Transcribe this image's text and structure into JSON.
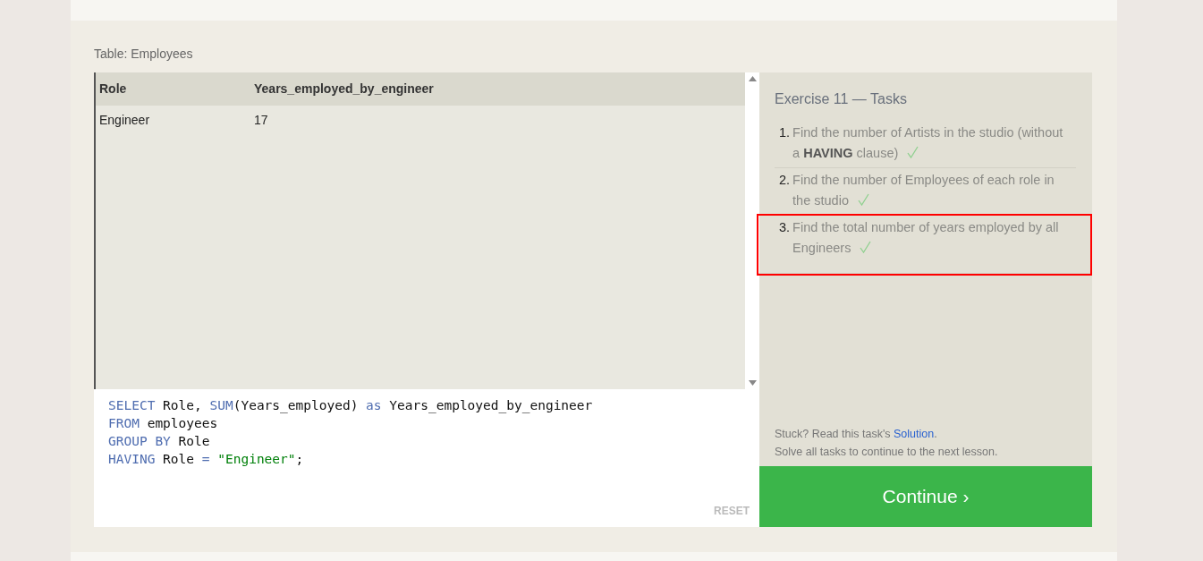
{
  "table_caption": "Table: Employees",
  "result_table": {
    "columns": [
      "Role",
      "Years_employed_by_engineer"
    ],
    "rows": [
      [
        "Engineer",
        "17"
      ]
    ]
  },
  "editor": {
    "lines": [
      [
        {
          "text": "SELECT",
          "kind": "keyword"
        },
        {
          "text": " Role, ",
          "kind": "plain"
        },
        {
          "text": "SUM",
          "kind": "keyword"
        },
        {
          "text": "(Years_employed) ",
          "kind": "plain"
        },
        {
          "text": "as",
          "kind": "keyword"
        },
        {
          "text": " Years_employed_by_engineer",
          "kind": "plain"
        }
      ],
      [
        {
          "text": "FROM",
          "kind": "keyword"
        },
        {
          "text": " employees",
          "kind": "plain"
        }
      ],
      [
        {
          "text": "GROUP BY",
          "kind": "keyword"
        },
        {
          "text": " Role",
          "kind": "plain"
        }
      ],
      [
        {
          "text": "HAVING",
          "kind": "keyword"
        },
        {
          "text": " Role ",
          "kind": "plain"
        },
        {
          "text": "=",
          "kind": "keyword"
        },
        {
          "text": " \"Engineer\"",
          "kind": "string"
        },
        {
          "text": ";",
          "kind": "plain"
        }
      ]
    ],
    "reset_label": "RESET"
  },
  "tasks_title": "Exercise 11 — Tasks",
  "tasks": [
    {
      "number": "1.",
      "text": "Find the number of Artists in the studio (without a **HAVING** clause)",
      "done": true,
      "highlighted": false
    },
    {
      "number": "2.",
      "text": "Find the number of Employees of each role in the studio",
      "done": true,
      "highlighted": false
    },
    {
      "number": "3.",
      "text": "Find the total number of years employed by all Engineers",
      "done": true,
      "highlighted": true
    }
  ],
  "hint": {
    "before": "Stuck? Read this task's ",
    "link": "Solution",
    "after": "."
  },
  "note": "Solve all tasks to continue to the next lesson.",
  "continue_button": "Continue ›"
}
